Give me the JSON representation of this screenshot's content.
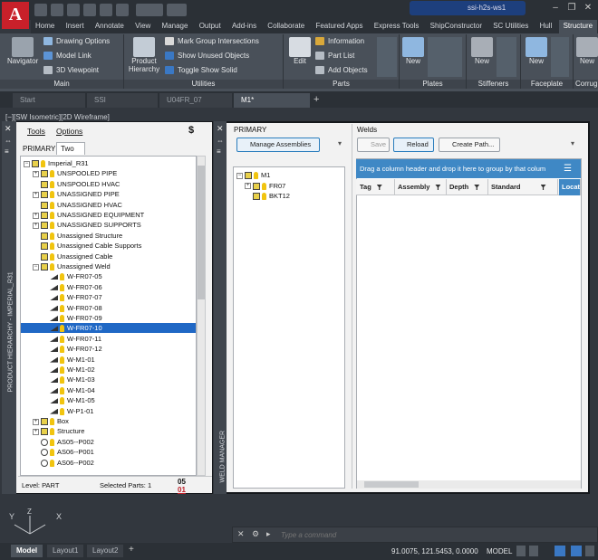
{
  "app": {
    "logo": "A",
    "window_title": "ssi-h2s-ws1"
  },
  "ribbon_tabs": [
    "Home",
    "Insert",
    "Annotate",
    "View",
    "Manage",
    "Output",
    "Add-ins",
    "Collaborate",
    "Featured Apps",
    "Express Tools",
    "ShipConstructor",
    "SC Utilities",
    "Hull",
    "Structure"
  ],
  "ribbon": {
    "navigator": "Navigator",
    "drawing_options": "Drawing Options",
    "model_link": "Model Link",
    "viewpoint_3d": "3D Viewpoint",
    "product_hierarchy": "Product Hierarchy",
    "mark_group": "Mark Group Intersections",
    "show_unused": "Show Unused Objects",
    "toggle_show_solid": "Toggle Show Solid",
    "edit": "Edit",
    "information": "Information",
    "part_list": "Part List",
    "add_objects": "Add Objects",
    "plates_new": "New",
    "stiffeners_new": "New",
    "faceplate_new": "New",
    "corrug_new": "New",
    "groups": {
      "main": "Main",
      "utilities": "Utilities",
      "parts": "Parts",
      "plates": "Plates",
      "stiffeners": "Stiffeners",
      "faceplate": "Faceplate",
      "corrug": "Corrug"
    }
  },
  "doc_tabs": [
    "Start",
    "SSI",
    "U04FR_07",
    "M1*"
  ],
  "view_label": "[−][SW Isometric][2D Wireframe]",
  "left_palette": {
    "menu_tools": "Tools",
    "menu_options": "Options",
    "tabs": [
      "PRIMARY",
      "Two"
    ],
    "strip_title": "PRODUCT HIERARCHY - IMPERIAL_R31",
    "tree": [
      {
        "label": "Imperial_R31",
        "level": 0,
        "pm": "−",
        "kind": "root"
      },
      {
        "label": "UNSPOOLED PIPE",
        "level": 1,
        "pm": "+",
        "kind": "folder"
      },
      {
        "label": "UNSPOOLED HVAC",
        "level": 1,
        "pm": "",
        "kind": "folder"
      },
      {
        "label": "UNASSIGNED PIPE",
        "level": 1,
        "pm": "+",
        "kind": "folder"
      },
      {
        "label": "UNASSIGNED HVAC",
        "level": 1,
        "pm": "",
        "kind": "folder"
      },
      {
        "label": "UNASSIGNED EQUIPMENT",
        "level": 1,
        "pm": "+",
        "kind": "folder"
      },
      {
        "label": "UNASSIGNED SUPPORTS",
        "level": 1,
        "pm": "+",
        "kind": "folder"
      },
      {
        "label": "Unassigned Structure",
        "level": 1,
        "pm": "",
        "kind": "folder"
      },
      {
        "label": "Unassigned Cable Supports",
        "level": 1,
        "pm": "",
        "kind": "folder"
      },
      {
        "label": "Unassigned Cable",
        "level": 1,
        "pm": "",
        "kind": "folder"
      },
      {
        "label": "Unassigned Weld",
        "level": 1,
        "pm": "−",
        "kind": "folder"
      },
      {
        "label": "W-FR07-05",
        "level": 2,
        "pm": "",
        "kind": "weld"
      },
      {
        "label": "W-FR07-06",
        "level": 2,
        "pm": "",
        "kind": "weld"
      },
      {
        "label": "W-FR07-07",
        "level": 2,
        "pm": "",
        "kind": "weld"
      },
      {
        "label": "W-FR07-08",
        "level": 2,
        "pm": "",
        "kind": "weld"
      },
      {
        "label": "W-FR07-09",
        "level": 2,
        "pm": "",
        "kind": "weld"
      },
      {
        "label": "W-FR07-10",
        "level": 2,
        "pm": "",
        "kind": "weld",
        "selected": true
      },
      {
        "label": "W-FR07-11",
        "level": 2,
        "pm": "",
        "kind": "weld"
      },
      {
        "label": "W-FR07-12",
        "level": 2,
        "pm": "",
        "kind": "weld"
      },
      {
        "label": "W-M1-01",
        "level": 2,
        "pm": "",
        "kind": "weld"
      },
      {
        "label": "W-M1-02",
        "level": 2,
        "pm": "",
        "kind": "weld"
      },
      {
        "label": "W-M1-03",
        "level": 2,
        "pm": "",
        "kind": "weld"
      },
      {
        "label": "W-M1-04",
        "level": 2,
        "pm": "",
        "kind": "weld"
      },
      {
        "label": "W-M1-05",
        "level": 2,
        "pm": "",
        "kind": "weld"
      },
      {
        "label": "W-P1-01",
        "level": 2,
        "pm": "",
        "kind": "weld"
      },
      {
        "label": "Box",
        "level": 1,
        "pm": "+",
        "kind": "folder"
      },
      {
        "label": "Structure",
        "level": 1,
        "pm": "+",
        "kind": "folder"
      },
      {
        "label": "AS05--P002",
        "level": 1,
        "pm": "",
        "kind": "part"
      },
      {
        "label": "AS06--P001",
        "level": 1,
        "pm": "",
        "kind": "part"
      },
      {
        "label": "AS06--P002",
        "level": 1,
        "pm": "",
        "kind": "part"
      }
    ],
    "status_level": "Level: PART",
    "status_selected": "Selected Parts: 1",
    "status_code": "05",
    "status_code2": "01"
  },
  "right_palette": {
    "strip_title": "WELD MANAGER",
    "primary_label": "PRIMARY",
    "manage_assemblies": "Manage Assemblies",
    "assembly_tree": [
      {
        "label": "M1",
        "level": 0,
        "pm": "−"
      },
      {
        "label": "FR07",
        "level": 1,
        "pm": "+"
      },
      {
        "label": "BKT12",
        "level": 1,
        "pm": ""
      }
    ],
    "welds_title": "Welds",
    "save": "Save",
    "reload": "Reload",
    "create_path": "Create Path...",
    "group_hint": "Drag a column header and drop it here to group by that colum",
    "columns": [
      "Tag",
      "Assembly",
      "Depth",
      "Standard",
      "Locat"
    ]
  },
  "command": {
    "placeholder": "Type a command"
  },
  "layout_tabs": [
    "Model",
    "Layout1",
    "Layout2"
  ],
  "coords": "91.0075, 121.5453, 0.0000",
  "model_label": "MODEL"
}
